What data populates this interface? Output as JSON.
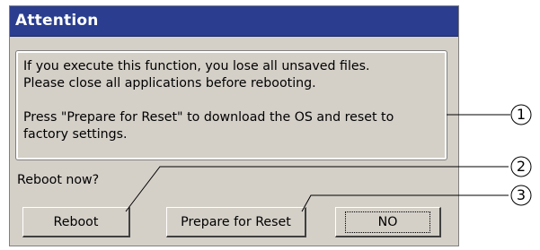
{
  "dialog": {
    "title": "Attention",
    "message_lines": [
      "If you execute this function, you lose all unsaved files.",
      "Please close all applications before rebooting.",
      "Press \"Prepare for Reset\" to download the OS and reset to",
      "factory settings."
    ],
    "prompt": "Reboot now?",
    "buttons": {
      "reboot": "Reboot",
      "prepare_reset": "Prepare for Reset",
      "no": "NO"
    }
  },
  "callouts": [
    "1",
    "2",
    "3"
  ],
  "colors": {
    "titlebar": "#2a3d8f",
    "dialog_bg": "#d4d0c8"
  }
}
